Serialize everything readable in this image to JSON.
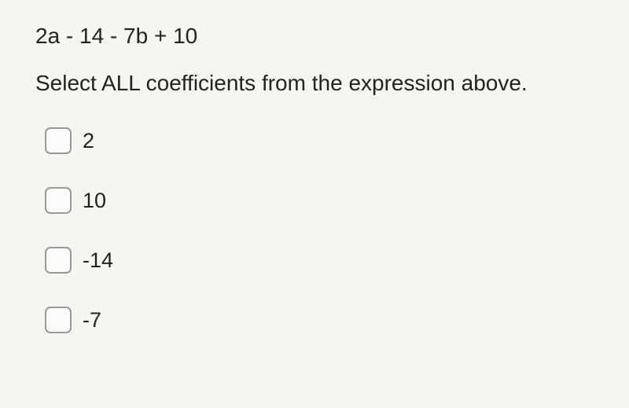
{
  "expression": "2a - 14 - 7b + 10",
  "question": "Select ALL coefficients from the expression above.",
  "options": [
    {
      "label": "2"
    },
    {
      "label": "10"
    },
    {
      "label": "-14"
    },
    {
      "label": "-7"
    }
  ]
}
